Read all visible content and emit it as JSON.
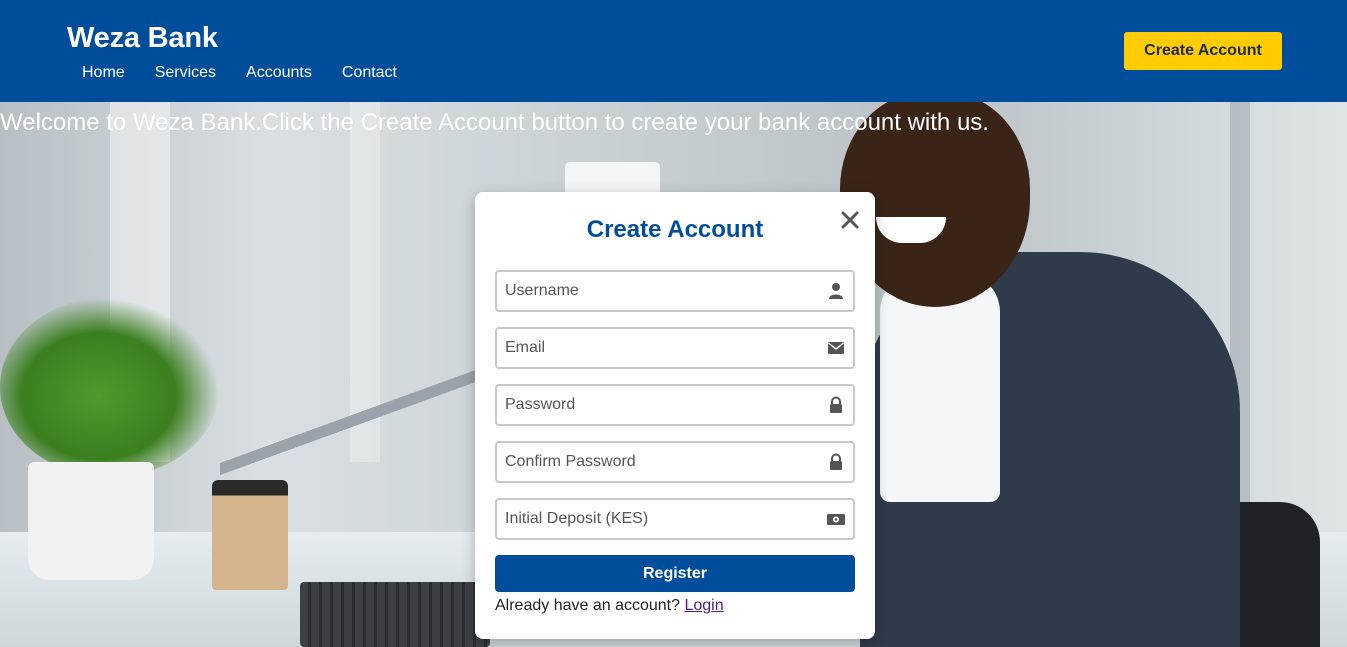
{
  "header": {
    "brand": "Weza Bank",
    "nav": [
      "Home",
      "Services",
      "Accounts",
      "Contact"
    ],
    "cta_label": "Create Account",
    "bg_color": "#004d9b",
    "cta_color": "#ffcc00"
  },
  "hero": {
    "welcome_text": "Welcome to Weza Bank.Click the Create Account button to create your bank account with us."
  },
  "modal": {
    "title": "Create Account",
    "close_icon": "close-icon",
    "fields": [
      {
        "placeholder": "Username",
        "value": "",
        "icon": "user-icon"
      },
      {
        "placeholder": "Email",
        "value": "",
        "icon": "envelope-icon"
      },
      {
        "placeholder": "Password",
        "value": "",
        "icon": "lock-icon"
      },
      {
        "placeholder": "Confirm Password",
        "value": "",
        "icon": "lock-icon"
      },
      {
        "placeholder": "Initial Deposit (KES)",
        "value": "",
        "icon": "money-icon"
      }
    ],
    "submit_label": "Register",
    "login_prompt": "Already have an account?",
    "login_link": "Login"
  }
}
